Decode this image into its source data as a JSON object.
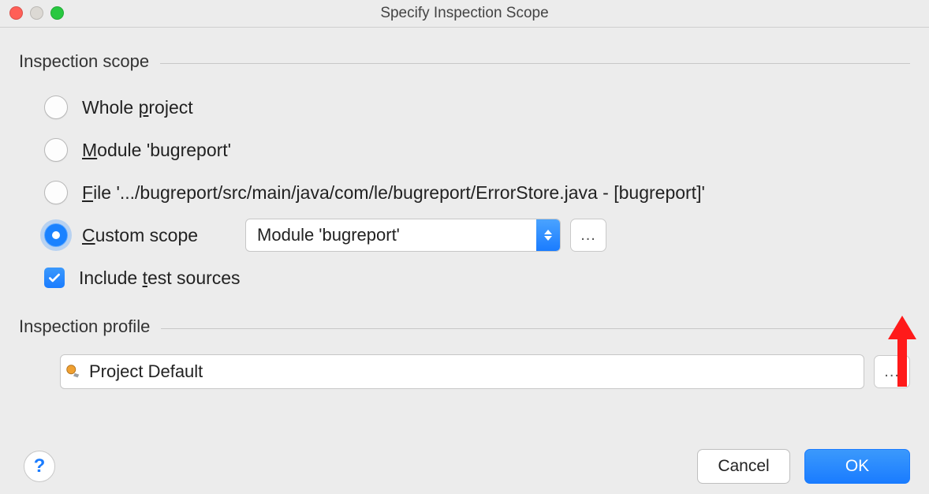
{
  "window": {
    "title": "Specify Inspection Scope"
  },
  "sections": {
    "scope_title": "Inspection scope",
    "profile_title": "Inspection profile"
  },
  "options": {
    "whole_before": "Whole ",
    "whole_u": "p",
    "whole_after": "roject",
    "module_u": "M",
    "module_after": "odule 'bugreport'",
    "file_u": "F",
    "file_after": "ile '.../bugreport/src/main/java/com/le/bugreport/ErrorStore.java - [bugreport]'",
    "custom_u": "C",
    "custom_after": "ustom scope",
    "include_before": "Include ",
    "include_u": "t",
    "include_after": "est sources"
  },
  "custom_scope": {
    "selected": "Module 'bugreport'",
    "ellipsis": "..."
  },
  "profile": {
    "selected": "Project Default",
    "ellipsis": "..."
  },
  "buttons": {
    "help": "?",
    "cancel": "Cancel",
    "ok": "OK"
  }
}
